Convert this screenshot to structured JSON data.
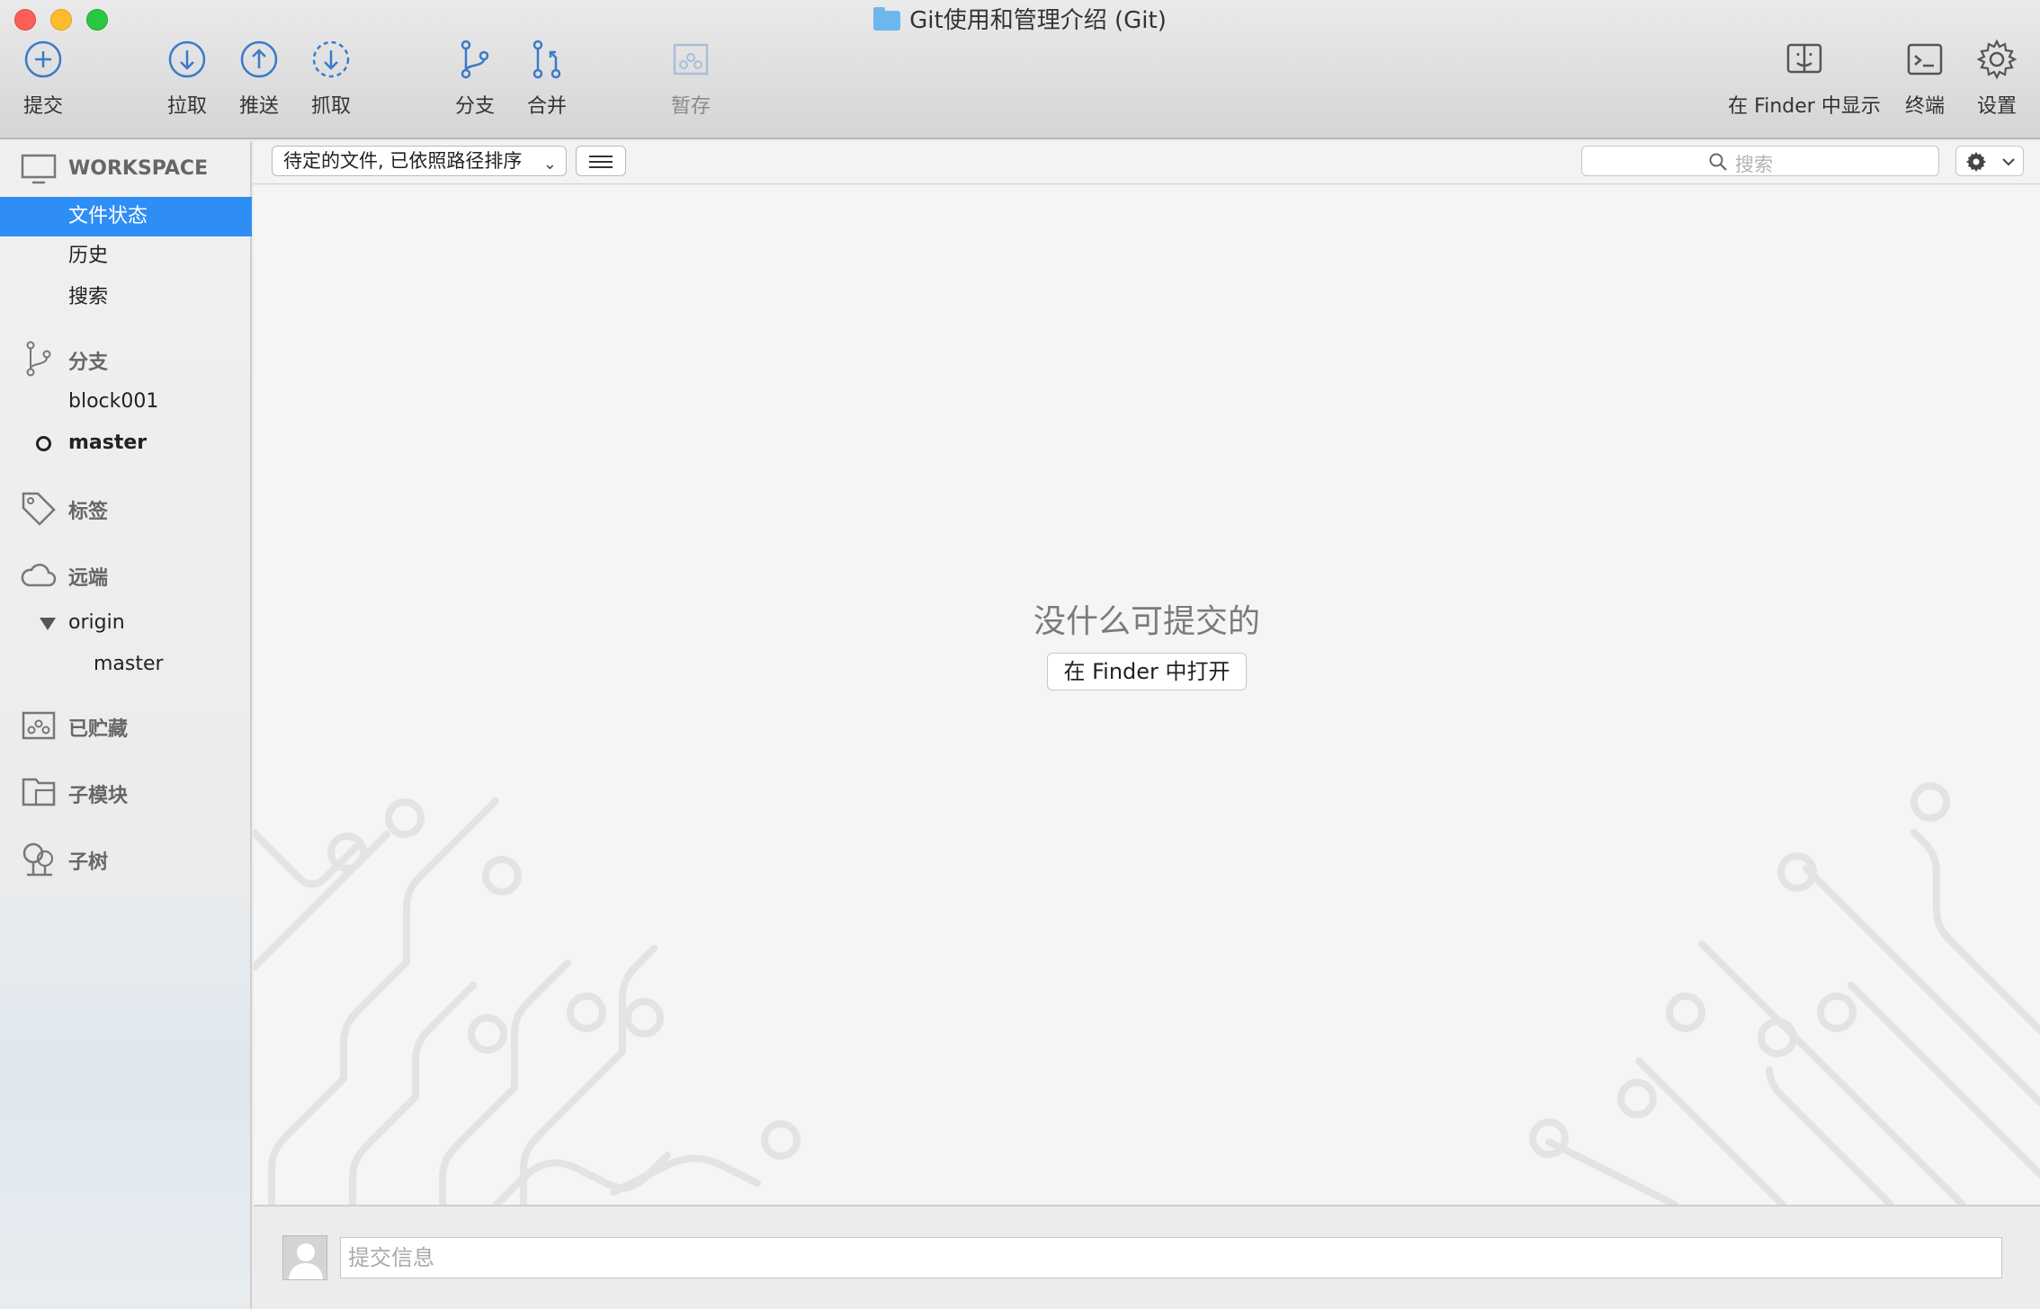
{
  "window": {
    "title": "Git使用和管理介绍 (Git)"
  },
  "toolbar": {
    "commit": "提交",
    "pull": "拉取",
    "push": "推送",
    "fetch": "抓取",
    "branch": "分支",
    "merge": "合并",
    "stash": "暂存",
    "show_in_finder": "在 Finder 中显示",
    "terminal": "终端",
    "settings": "设置"
  },
  "sidebar": {
    "workspace": {
      "header": "WORKSPACE",
      "items": [
        "文件状态",
        "历史",
        "搜索"
      ],
      "selected": "文件状态"
    },
    "branches": {
      "header": "分支",
      "items": [
        "block001",
        "master"
      ],
      "current": "master"
    },
    "tags": {
      "header": "标签"
    },
    "remotes": {
      "header": "远端",
      "remote": "origin",
      "remote_branches": [
        "master"
      ]
    },
    "stashes": {
      "header": "已贮藏"
    },
    "submodules": {
      "header": "子模块"
    },
    "subtrees": {
      "header": "子树"
    }
  },
  "filterbar": {
    "dropdown_value": "待定的文件, 已依照路径排序",
    "search_placeholder": "搜索"
  },
  "main": {
    "empty_title": "没什么可提交的",
    "open_in_finder": "在 Finder 中打开"
  },
  "commit": {
    "placeholder": "提交信息"
  },
  "colors": {
    "accent": "#2f8df6",
    "icon_blue": "#3a7bc8"
  }
}
